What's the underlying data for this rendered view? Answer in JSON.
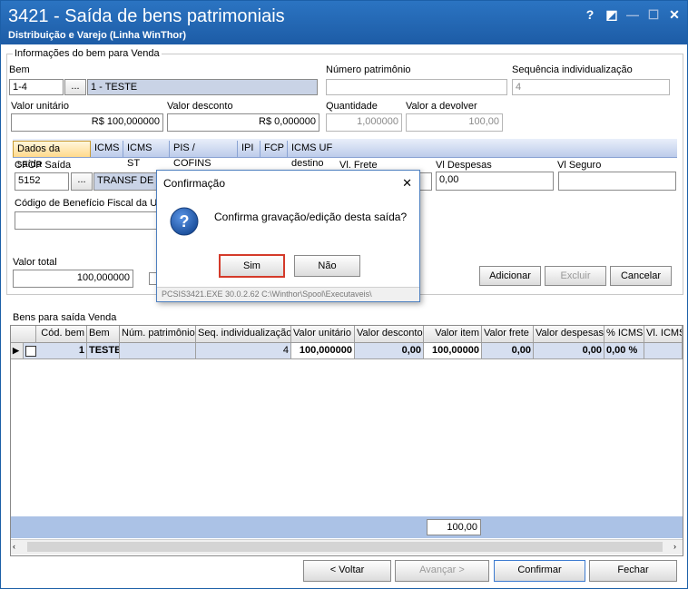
{
  "window": {
    "title": "3421 - Saída de bens patrimoniais",
    "subtitle": "Distribuição e Varejo (Linha WinThor)",
    "controls": {
      "help": "?",
      "restore": "◩",
      "minimize": "—",
      "maximize": "☐",
      "close": "✕"
    }
  },
  "info_group": {
    "label": "Informações do bem para Venda"
  },
  "bem": {
    "label": "Bem",
    "code": "1-4",
    "button": "...",
    "desc": "1 - TESTE"
  },
  "numero_patrimonio": {
    "label": "Número patrimônio",
    "value": ""
  },
  "sequencia": {
    "label": "Sequência individualização",
    "value": "4"
  },
  "valor_unitario": {
    "label": "Valor unitário",
    "value": "R$ 100,000000"
  },
  "valor_desconto": {
    "label": "Valor desconto",
    "value": "R$ 0,000000"
  },
  "quantidade": {
    "label": "Quantidade",
    "value": "1,000000"
  },
  "valor_devolver": {
    "label": "Valor a devolver",
    "value": "100,00"
  },
  "tabs": [
    "Dados da saída",
    "ICMS",
    "ICMS ST",
    "PIS / COFINS",
    "IPI",
    "FCP",
    "ICMS UF destino"
  ],
  "cfop": {
    "label": "CFOP Saída",
    "code": "5152",
    "button": "...",
    "desc": "TRANSF DE ME"
  },
  "vl_frete": {
    "label": "Vl. Frete"
  },
  "vl_despesas": {
    "label": "Vl Despesas",
    "value": "0,00"
  },
  "vl_seguro": {
    "label": "Vl Seguro",
    "value": ""
  },
  "codigo_beneficio": {
    "label": "Código de Benefício Fiscal da UF",
    "value": ""
  },
  "valor_total": {
    "label": "Valor total",
    "value": "100,000000"
  },
  "actions": {
    "adicionar": "Adicionar",
    "excluir": "Excluir",
    "cancelar": "Cancelar"
  },
  "grid": {
    "label": "Bens para saída Venda",
    "columns": [
      "Cód. bem",
      "Bem",
      "Núm. patrimônio",
      "Seq. individualização",
      "Valor unitário",
      "Valor desconto",
      "Valor item",
      "Valor frete",
      "Valor despesas",
      "% ICMS",
      "Vl. ICMS"
    ],
    "rows": [
      {
        "indicator": "▶",
        "cod": "1",
        "bem": "TESTE",
        "num": "",
        "seq": "4",
        "vu": "100,000000",
        "vd": "0,00",
        "vi": "100,00000",
        "vf": "0,00",
        "vdes": "0,00",
        "picms": "0,00 %",
        "vicms": ""
      }
    ],
    "total": "100,00"
  },
  "nav": {
    "voltar": "< Voltar",
    "avancar": "Avançar >",
    "confirmar": "Confirmar",
    "fechar": "Fechar"
  },
  "dialog": {
    "title": "Confirmação",
    "close": "✕",
    "icon": "question-icon",
    "message": "Confirma gravação/edição desta saída?",
    "yes": "Sim",
    "no": "Não",
    "status": "PCSIS3421.EXE 30.0.2.62 C:\\Winthor\\Spool\\Executaveis\\"
  }
}
